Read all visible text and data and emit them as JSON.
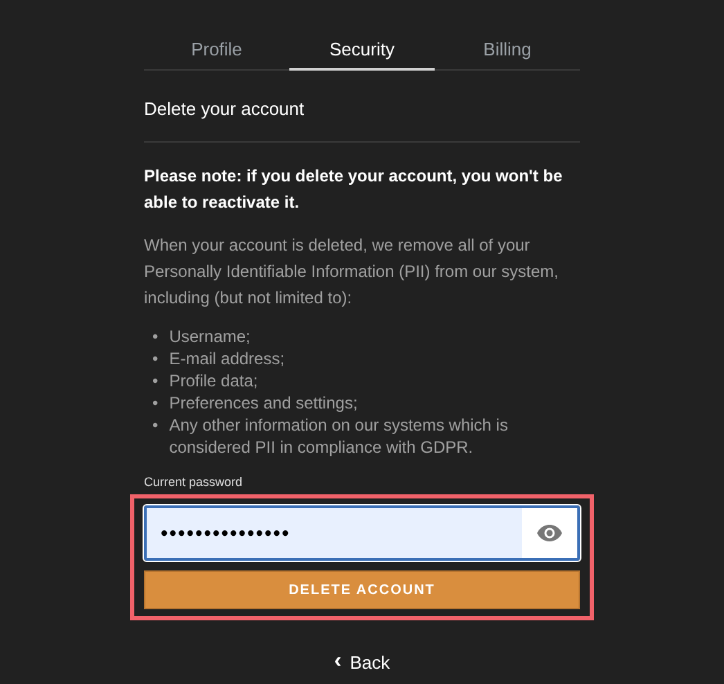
{
  "tabs": [
    {
      "label": "Profile",
      "selected": false
    },
    {
      "label": "Security",
      "selected": true
    },
    {
      "label": "Billing",
      "selected": false
    }
  ],
  "heading": "Delete your account",
  "warning": "Please note: if you delete your account, you won't be able to reactivate it.",
  "intro": "When your account is deleted, we remove all of your Personally Identifiable Information (PII) from our system, including (but not limited to):",
  "bullet": "•",
  "items": [
    "Username;",
    "E-mail address;",
    "Profile data;",
    "Preferences and settings;",
    "Any other information on our systems which is considered PII in compliance with GDPR."
  ],
  "password": {
    "label": "Current password",
    "value": "•••••••••••••••"
  },
  "delete_button": "DELETE ACCOUNT",
  "back": {
    "icon": "‹",
    "label": "Back"
  }
}
